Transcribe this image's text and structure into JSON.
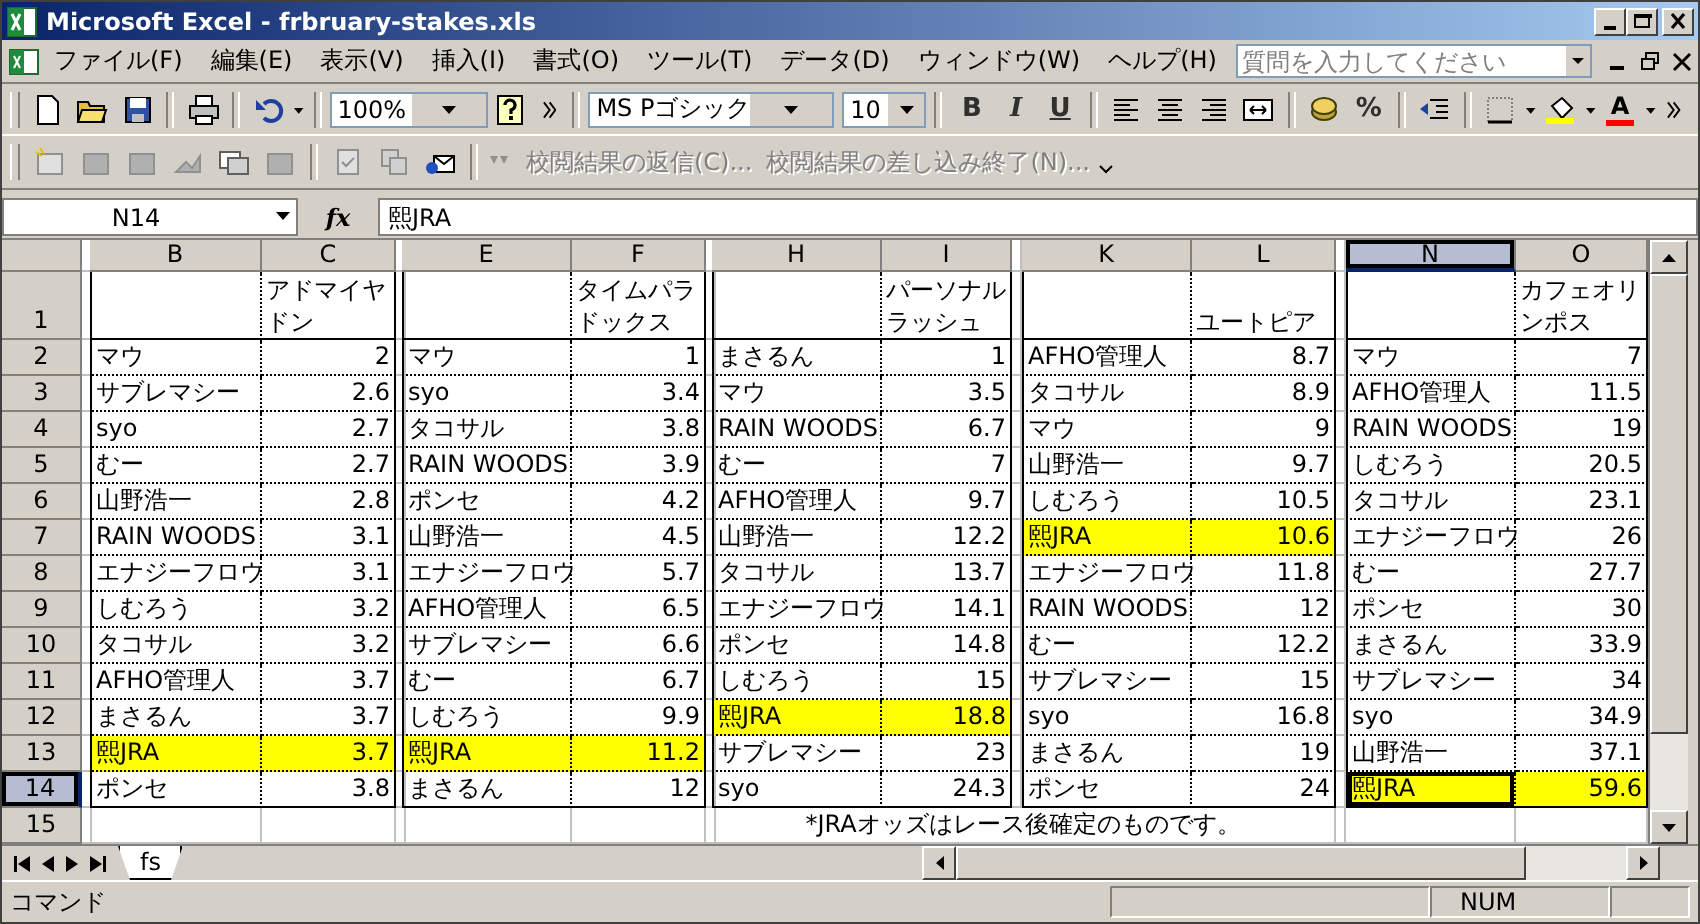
{
  "window": {
    "title": "Microsoft Excel - frbruary-stakes.xls"
  },
  "menu": [
    "ファイル(F)",
    "編集(E)",
    "表示(V)",
    "挿入(I)",
    "書式(O)",
    "ツール(T)",
    "データ(D)",
    "ウィンドウ(W)",
    "ヘルプ(H)"
  ],
  "help_search": {
    "placeholder": "質問を入力してください"
  },
  "toolbar": {
    "zoom": "100%",
    "font": "MS Pゴシック",
    "size": "10",
    "bold": "B",
    "italic": "I",
    "underline": "U",
    "percent": "%",
    "font_color": "A"
  },
  "review_toolbar": [
    {
      "label": "校閲結果の返信(C)...",
      "disabled": true
    },
    {
      "label": "校閲結果の差し込み終了(N)...",
      "disabled": true
    }
  ],
  "formula_bar": {
    "name_box": "N14",
    "fx": "fx",
    "value": "熙JRA"
  },
  "sheet": {
    "columns": [
      {
        "label": "B",
        "selected": false
      },
      {
        "label": "C",
        "selected": false
      },
      {
        "label": "E",
        "selected": false
      },
      {
        "label": "F",
        "selected": false
      },
      {
        "label": "H",
        "selected": false
      },
      {
        "label": "I",
        "selected": false
      },
      {
        "label": "K",
        "selected": false
      },
      {
        "label": "L",
        "selected": false
      },
      {
        "label": "N",
        "selected": true
      },
      {
        "label": "O",
        "selected": false
      }
    ],
    "rows": [
      {
        "label": "1",
        "selected": false
      },
      {
        "label": "2",
        "selected": false
      },
      {
        "label": "3",
        "selected": false
      },
      {
        "label": "4",
        "selected": false
      },
      {
        "label": "5",
        "selected": false
      },
      {
        "label": "6",
        "selected": false
      },
      {
        "label": "7",
        "selected": false
      },
      {
        "label": "8",
        "selected": false
      },
      {
        "label": "9",
        "selected": false
      },
      {
        "label": "10",
        "selected": false
      },
      {
        "label": "11",
        "selected": false
      },
      {
        "label": "12",
        "selected": false
      },
      {
        "label": "13",
        "selected": false
      },
      {
        "label": "14",
        "selected": true
      },
      {
        "label": "15",
        "selected": false
      }
    ],
    "races": [
      {
        "title": "アドマイヤドン",
        "entries": [
          {
            "name": "マウ",
            "odds": "2",
            "highlighted": false,
            "selected": false
          },
          {
            "name": "サブレマシー",
            "odds": "2.6",
            "highlighted": false,
            "selected": false
          },
          {
            "name": "syo",
            "odds": "2.7",
            "highlighted": false,
            "selected": false
          },
          {
            "name": "むー",
            "odds": "2.7",
            "highlighted": false,
            "selected": false
          },
          {
            "name": "山野浩一",
            "odds": "2.8",
            "highlighted": false,
            "selected": false
          },
          {
            "name": "RAIN WOODS",
            "odds": "3.1",
            "highlighted": false,
            "selected": false
          },
          {
            "name": "エナジーフロウ",
            "odds": "3.1",
            "highlighted": false,
            "selected": false
          },
          {
            "name": "しむろう",
            "odds": "3.2",
            "highlighted": false,
            "selected": false
          },
          {
            "name": "タコサル",
            "odds": "3.2",
            "highlighted": false,
            "selected": false
          },
          {
            "name": "AFHO管理人",
            "odds": "3.7",
            "highlighted": false,
            "selected": false
          },
          {
            "name": "まさるん",
            "odds": "3.7",
            "highlighted": false,
            "selected": false
          },
          {
            "name": "熙JRA",
            "odds": "3.7",
            "highlighted": true,
            "selected": false
          },
          {
            "name": "ポンセ",
            "odds": "3.8",
            "highlighted": false,
            "selected": false
          }
        ]
      },
      {
        "title": "タイムパラドックス",
        "entries": [
          {
            "name": "マウ",
            "odds": "1",
            "highlighted": false,
            "selected": false
          },
          {
            "name": "syo",
            "odds": "3.4",
            "highlighted": false,
            "selected": false
          },
          {
            "name": "タコサル",
            "odds": "3.8",
            "highlighted": false,
            "selected": false
          },
          {
            "name": "RAIN WOODS",
            "odds": "3.9",
            "highlighted": false,
            "selected": false
          },
          {
            "name": "ポンセ",
            "odds": "4.2",
            "highlighted": false,
            "selected": false
          },
          {
            "name": "山野浩一",
            "odds": "4.5",
            "highlighted": false,
            "selected": false
          },
          {
            "name": "エナジーフロウ",
            "odds": "5.7",
            "highlighted": false,
            "selected": false
          },
          {
            "name": "AFHO管理人",
            "odds": "6.5",
            "highlighted": false,
            "selected": false
          },
          {
            "name": "サブレマシー",
            "odds": "6.6",
            "highlighted": false,
            "selected": false
          },
          {
            "name": "むー",
            "odds": "6.7",
            "highlighted": false,
            "selected": false
          },
          {
            "name": "しむろう",
            "odds": "9.9",
            "highlighted": false,
            "selected": false
          },
          {
            "name": "熙JRA",
            "odds": "11.2",
            "highlighted": true,
            "selected": false
          },
          {
            "name": "まさるん",
            "odds": "12",
            "highlighted": false,
            "selected": false
          }
        ]
      },
      {
        "title": "パーソナルラッシュ",
        "entries": [
          {
            "name": "まさるん",
            "odds": "1",
            "highlighted": false,
            "selected": false
          },
          {
            "name": "マウ",
            "odds": "3.5",
            "highlighted": false,
            "selected": false
          },
          {
            "name": "RAIN WOODS",
            "odds": "6.7",
            "highlighted": false,
            "selected": false
          },
          {
            "name": "むー",
            "odds": "7",
            "highlighted": false,
            "selected": false
          },
          {
            "name": "AFHO管理人",
            "odds": "9.7",
            "highlighted": false,
            "selected": false
          },
          {
            "name": "山野浩一",
            "odds": "12.2",
            "highlighted": false,
            "selected": false
          },
          {
            "name": "タコサル",
            "odds": "13.7",
            "highlighted": false,
            "selected": false
          },
          {
            "name": "エナジーフロウ",
            "odds": "14.1",
            "highlighted": false,
            "selected": false
          },
          {
            "name": "ポンセ",
            "odds": "14.8",
            "highlighted": false,
            "selected": false
          },
          {
            "name": "しむろう",
            "odds": "15",
            "highlighted": false,
            "selected": false
          },
          {
            "name": "熙JRA",
            "odds": "18.8",
            "highlighted": true,
            "selected": false
          },
          {
            "name": "サブレマシー",
            "odds": "23",
            "highlighted": false,
            "selected": false
          },
          {
            "name": "syo",
            "odds": "24.3",
            "highlighted": false,
            "selected": false
          }
        ]
      },
      {
        "title": "ユートピア",
        "entries": [
          {
            "name": "AFHO管理人",
            "odds": "8.7",
            "highlighted": false,
            "selected": false
          },
          {
            "name": "タコサル",
            "odds": "8.9",
            "highlighted": false,
            "selected": false
          },
          {
            "name": "マウ",
            "odds": "9",
            "highlighted": false,
            "selected": false
          },
          {
            "name": "山野浩一",
            "odds": "9.7",
            "highlighted": false,
            "selected": false
          },
          {
            "name": "しむろう",
            "odds": "10.5",
            "highlighted": false,
            "selected": false
          },
          {
            "name": "熙JRA",
            "odds": "10.6",
            "highlighted": true,
            "selected": false
          },
          {
            "name": "エナジーフロウ",
            "odds": "11.8",
            "highlighted": false,
            "selected": false
          },
          {
            "name": "RAIN WOODS",
            "odds": "12",
            "highlighted": false,
            "selected": false
          },
          {
            "name": "むー",
            "odds": "12.2",
            "highlighted": false,
            "selected": false
          },
          {
            "name": "サブレマシー",
            "odds": "15",
            "highlighted": false,
            "selected": false
          },
          {
            "name": "syo",
            "odds": "16.8",
            "highlighted": false,
            "selected": false
          },
          {
            "name": "まさるん",
            "odds": "19",
            "highlighted": false,
            "selected": false
          },
          {
            "name": "ポンセ",
            "odds": "24",
            "highlighted": false,
            "selected": false
          }
        ]
      },
      {
        "title": "カフェオリンポス",
        "entries": [
          {
            "name": "マウ",
            "odds": "7",
            "highlighted": false,
            "selected": false
          },
          {
            "name": "AFHO管理人",
            "odds": "11.5",
            "highlighted": false,
            "selected": false
          },
          {
            "name": "RAIN WOODS",
            "odds": "19",
            "highlighted": false,
            "selected": false
          },
          {
            "name": "しむろう",
            "odds": "20.5",
            "highlighted": false,
            "selected": false
          },
          {
            "name": "タコサル",
            "odds": "23.1",
            "highlighted": false,
            "selected": false
          },
          {
            "name": "エナジーフロウ",
            "odds": "26",
            "highlighted": false,
            "selected": false
          },
          {
            "name": "むー",
            "odds": "27.7",
            "highlighted": false,
            "selected": false
          },
          {
            "name": "ポンセ",
            "odds": "30",
            "highlighted": false,
            "selected": false
          },
          {
            "name": "まさるん",
            "odds": "33.9",
            "highlighted": false,
            "selected": false
          },
          {
            "name": "サブレマシー",
            "odds": "34",
            "highlighted": false,
            "selected": false
          },
          {
            "name": "syo",
            "odds": "34.9",
            "highlighted": false,
            "selected": false
          },
          {
            "name": "山野浩一",
            "odds": "37.1",
            "highlighted": false,
            "selected": false
          },
          {
            "name": "熙JRA",
            "odds": "59.6",
            "highlighted": true,
            "selected": true
          }
        ]
      }
    ],
    "note": "*JRAオッズはレース後確定のものです。"
  },
  "sheet_tabs": [
    {
      "label": "fs",
      "selected": true
    }
  ],
  "status_bar": {
    "mode": "コマンド",
    "indicator": "NUM"
  }
}
